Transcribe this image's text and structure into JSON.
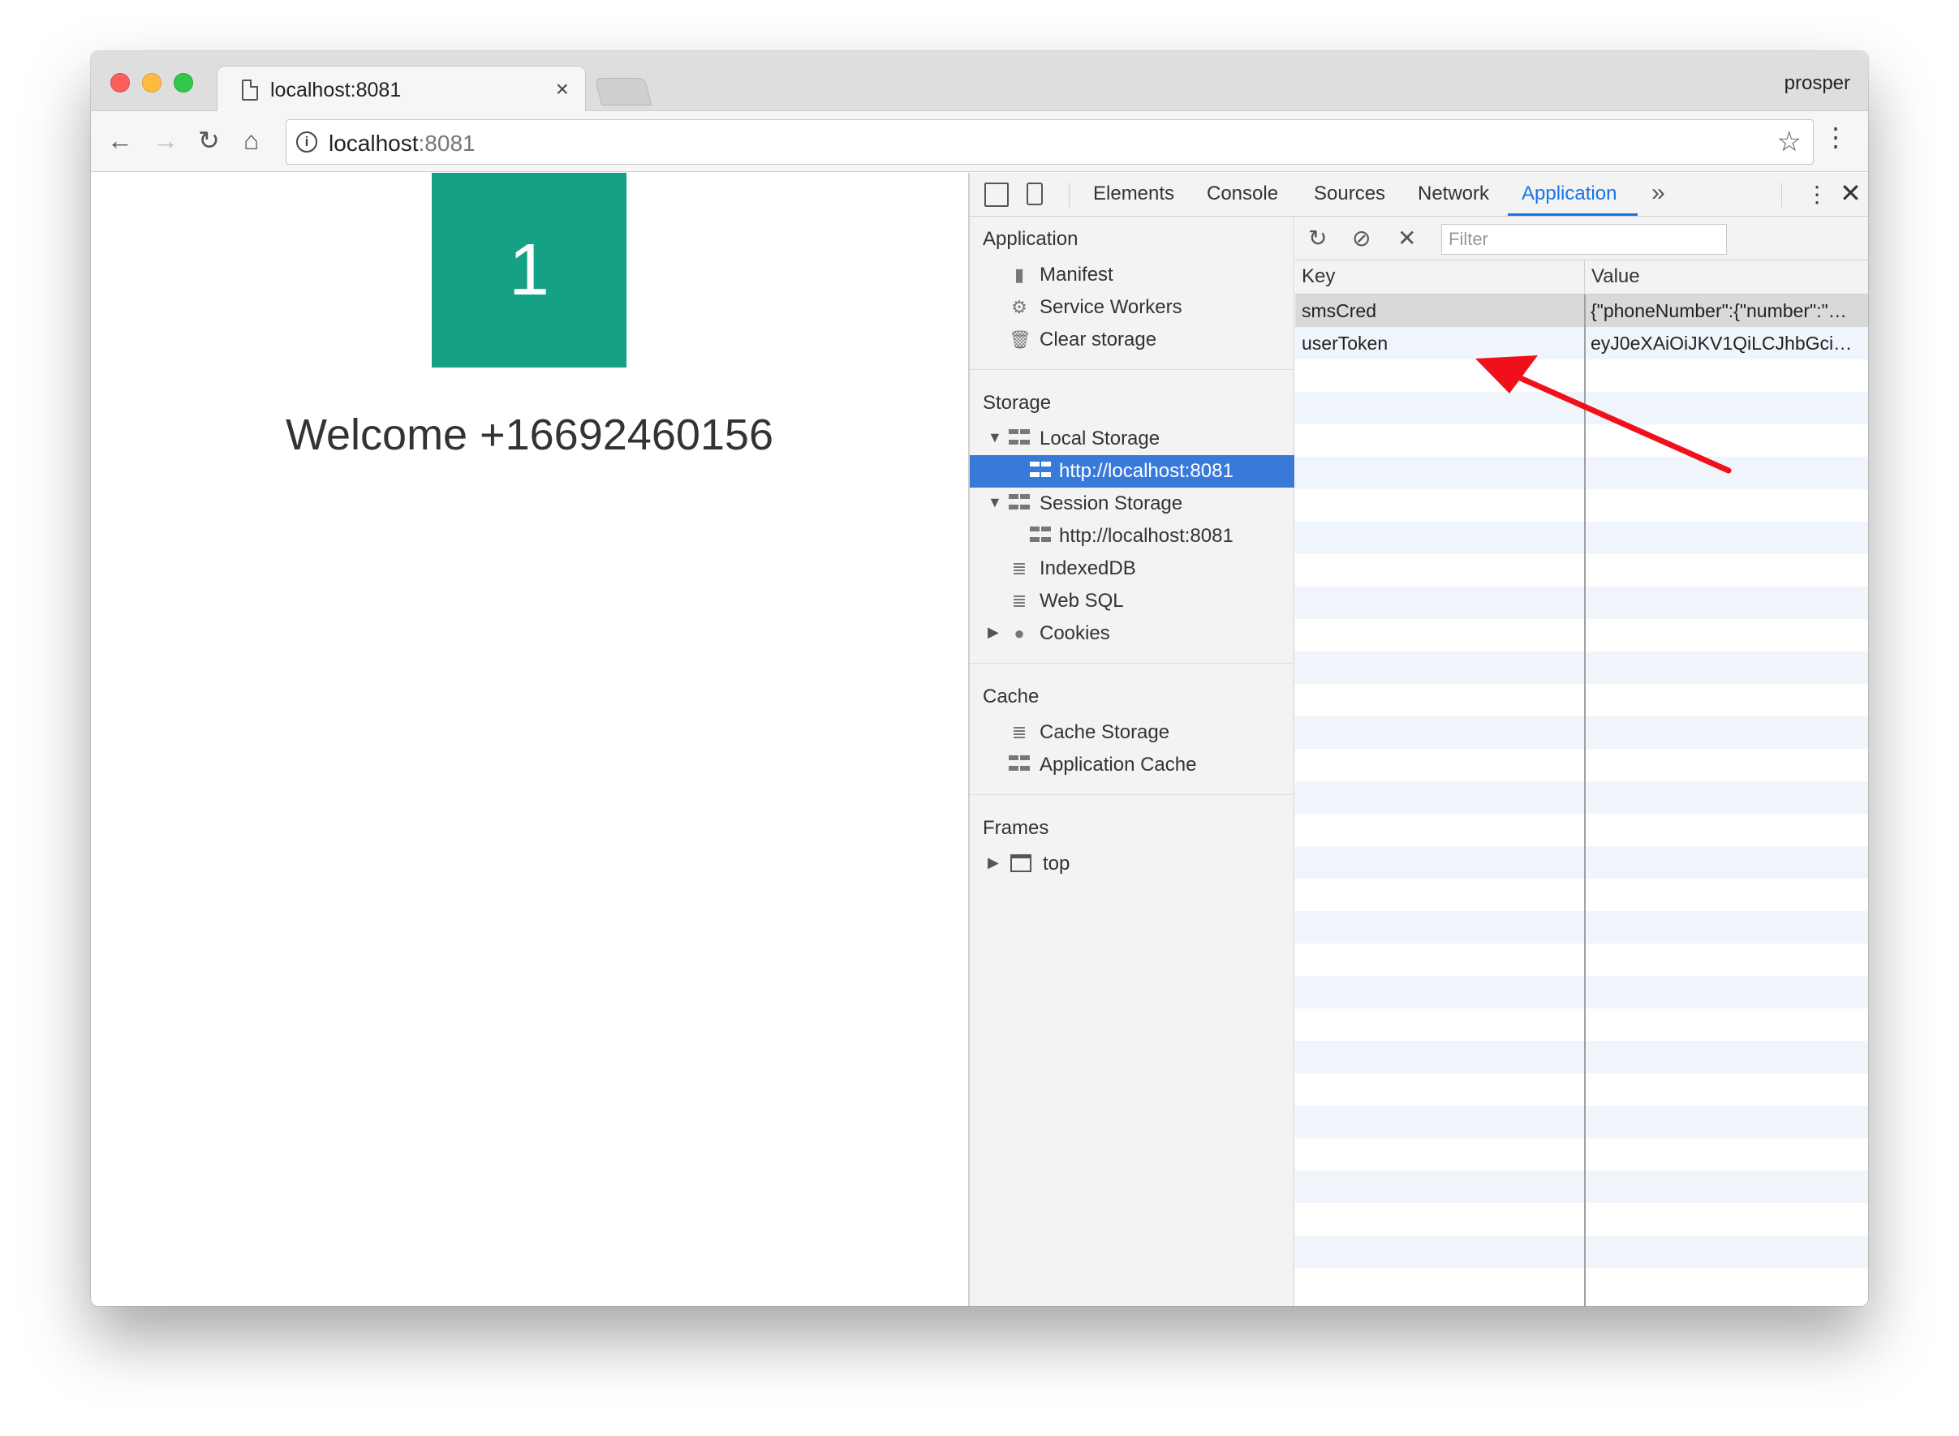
{
  "browser": {
    "tab_title": "localhost:8081",
    "tab_close": "×",
    "profile_name": "prosper",
    "url_host": "localhost",
    "url_port": ":8081"
  },
  "page": {
    "badge_number": "1",
    "welcome_text": "Welcome +16692460156",
    "badge_color": "#16a085"
  },
  "devtools": {
    "tabs": [
      "Elements",
      "Console",
      "Sources",
      "Network",
      "Application"
    ],
    "active_tab": "Application",
    "sidebar": {
      "application_title": "Application",
      "application_items": [
        "Manifest",
        "Service Workers",
        "Clear storage"
      ],
      "storage_title": "Storage",
      "local_storage": "Local Storage",
      "local_storage_origin": "http://localhost:8081",
      "session_storage": "Session Storage",
      "session_storage_origin": "http://localhost:8081",
      "indexeddb": "IndexedDB",
      "websql": "Web SQL",
      "cookies": "Cookies",
      "cache_title": "Cache",
      "cache_items": [
        "Cache Storage",
        "Application Cache"
      ],
      "frames_title": "Frames",
      "frames_top": "top"
    },
    "storage_panel": {
      "filter_placeholder": "Filter",
      "columns": {
        "key": "Key",
        "value": "Value"
      },
      "rows": [
        {
          "key": "smsCred",
          "value": "{\"phoneNumber\":{\"number\":\"…"
        },
        {
          "key": "userToken",
          "value": "eyJ0eXAiOiJKV1QiLCJhbGci…"
        }
      ]
    },
    "accent_color": "#1a73e8",
    "selection_color": "#3879d9"
  },
  "annotation": {
    "arrow_color": "#f0101a"
  }
}
